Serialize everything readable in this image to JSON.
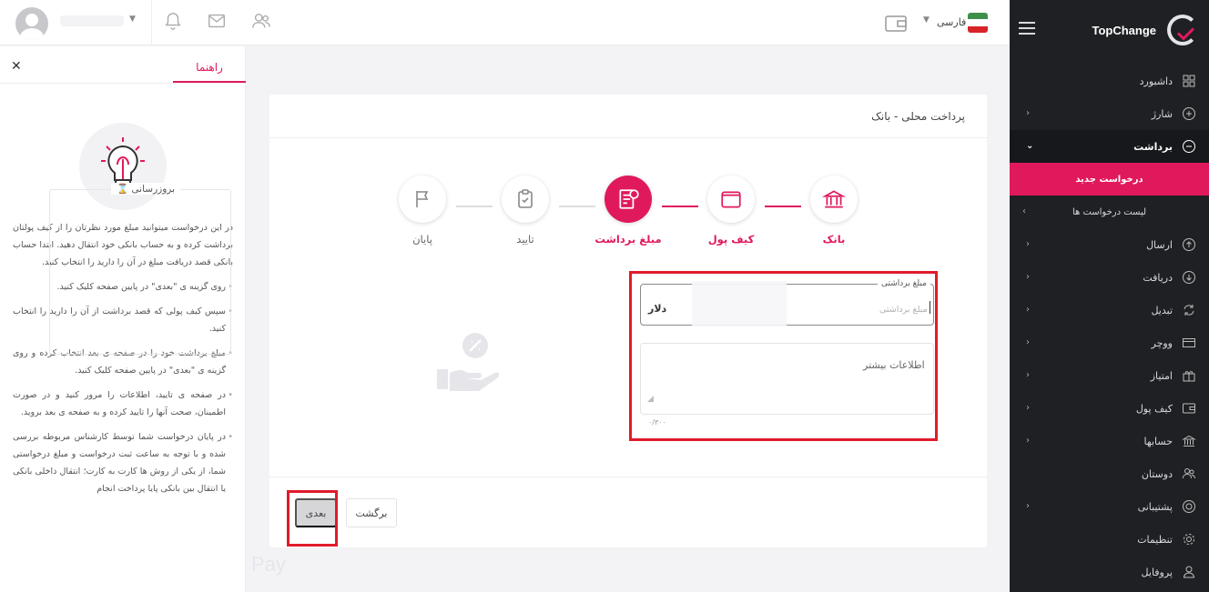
{
  "app": {
    "name": "TopChange"
  },
  "topbar": {
    "language": "فارسی",
    "icons": [
      "bell-icon",
      "mail-icon",
      "users-icon",
      "wallet-icon"
    ]
  },
  "sidebar": {
    "items": [
      {
        "label": "داشبورد",
        "icon": "grid-icon",
        "has_children": false
      },
      {
        "label": "شارژ",
        "icon": "plus-circle-icon",
        "has_children": true
      },
      {
        "label": "برداشت",
        "icon": "minus-circle-icon",
        "has_children": true,
        "expanded": true
      },
      {
        "label": "ارسال",
        "icon": "arrow-up-circle-icon",
        "has_children": true
      },
      {
        "label": "دریافت",
        "icon": "arrow-down-circle-icon",
        "has_children": true
      },
      {
        "label": "تبدیل",
        "icon": "exchange-icon",
        "has_children": true
      },
      {
        "label": "ووچر",
        "icon": "card-icon",
        "has_children": true
      },
      {
        "label": "امتیاز",
        "icon": "gift-icon",
        "has_children": true
      },
      {
        "label": "کیف پول",
        "icon": "wallet-icon",
        "has_children": true
      },
      {
        "label": "حسابها",
        "icon": "bank-icon",
        "has_children": true
      },
      {
        "label": "دوستان",
        "icon": "friends-icon",
        "has_children": false
      },
      {
        "label": "پشتیبانی",
        "icon": "lifebuoy-icon",
        "has_children": true
      },
      {
        "label": "تنظیمات",
        "icon": "gear-icon",
        "has_children": false
      },
      {
        "label": "پروفایل",
        "icon": "user-icon",
        "has_children": false
      }
    ],
    "subitems": [
      {
        "label": "درخواست جدید",
        "current": true
      },
      {
        "label": "لیست درخواست ها",
        "current": false
      }
    ]
  },
  "help": {
    "tab": "راهنما",
    "intro": "در این درخواست میتوانید مبلغ مورد نظرتان را از کیف پولتان برداشت کرده و به حساب بانکی خود انتقال دهید. ابتدا حساب بانکی قصد دریافت مبلغ در آن را دارید را انتخاب کنید.",
    "bullets": [
      "روی گزینه ی \"بعدی\" در پایین صفحه کلیک کنید.",
      "سپس کیف پولی که قصد برداشت از آن را دارید را انتخاب کنید.",
      "مبلغ برداشت خود را در صفحه ی بعد انتخاب کرده و روی گزینه ی \"بعدی\" در پایین صفحه کلیک کنید.",
      "در صفحه ی تایید، اطلاعات را مرور کنید و در صورت اطمینان، صحت آنها را تایید کرده و به صفحه ی بعد بروید.",
      "در پایان درخواست شما توسط کارشناس مربوطه بررسی شده و با توجه به ساعت ثبت درخواست و مبلغ درخواستی شما، از یکی از روش ها کارت به کارت؛ انتقال داخلی بانکی یا انتقال بین بانکی پایا پرداخت انجام"
    ]
  },
  "main": {
    "title": "پرداخت محلی - بانک",
    "steps": [
      {
        "label": "بانک",
        "icon": "bank-icon",
        "state": "done"
      },
      {
        "label": "کیف پول",
        "icon": "wallet-icon",
        "state": "done"
      },
      {
        "label": "مبلغ برداشت",
        "icon": "invoice-icon",
        "state": "current"
      },
      {
        "label": "تایید",
        "icon": "clipboard-icon",
        "state": "todo"
      },
      {
        "label": "پایان",
        "icon": "flag-icon",
        "state": "todo"
      }
    ],
    "preview_label": "بروزرسانی",
    "amount": {
      "label": "مبلغ برداشتی",
      "placeholder": "مبلغ برداشتی",
      "unit": "دلار",
      "value": ""
    },
    "more": {
      "placeholder": "اطلاعات بیشتر",
      "counter": "۰/۳۰۰"
    },
    "buttons": {
      "next": "بعدی",
      "back": "برگشت"
    }
  },
  "colors": {
    "accent": "#e0195c",
    "sidebar_bg": "#1f2023",
    "highlight_box": "#e01b2b"
  }
}
